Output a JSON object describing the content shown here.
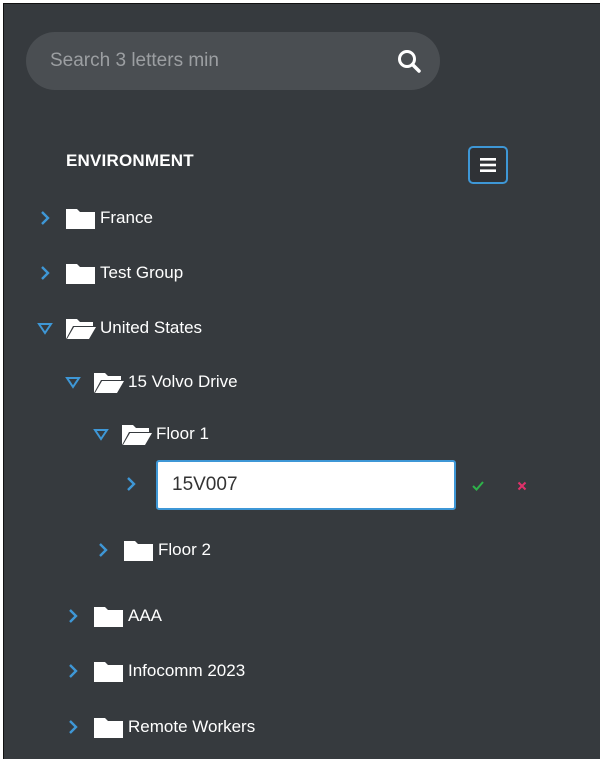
{
  "search": {
    "placeholder": "Search 3 letters min",
    "icon": "search-icon"
  },
  "header": {
    "title": "ENVIRONMENT",
    "menu_icon": "hamburger-menu-icon"
  },
  "tree": {
    "france": "France",
    "test_group": "Test Group",
    "united_states": "United States",
    "volvo_drive": "15 Volvo Drive",
    "floor1": "Floor 1",
    "edit_value": "15V007",
    "floor2": "Floor 2",
    "aaa": "AAA",
    "infocomm": "Infocomm 2023",
    "remote_workers": "Remote Workers"
  },
  "colors": {
    "accent": "#3e97d6",
    "confirm": "#2eb34a",
    "cancel": "#e0316a",
    "panel_bg": "#363a3e"
  }
}
